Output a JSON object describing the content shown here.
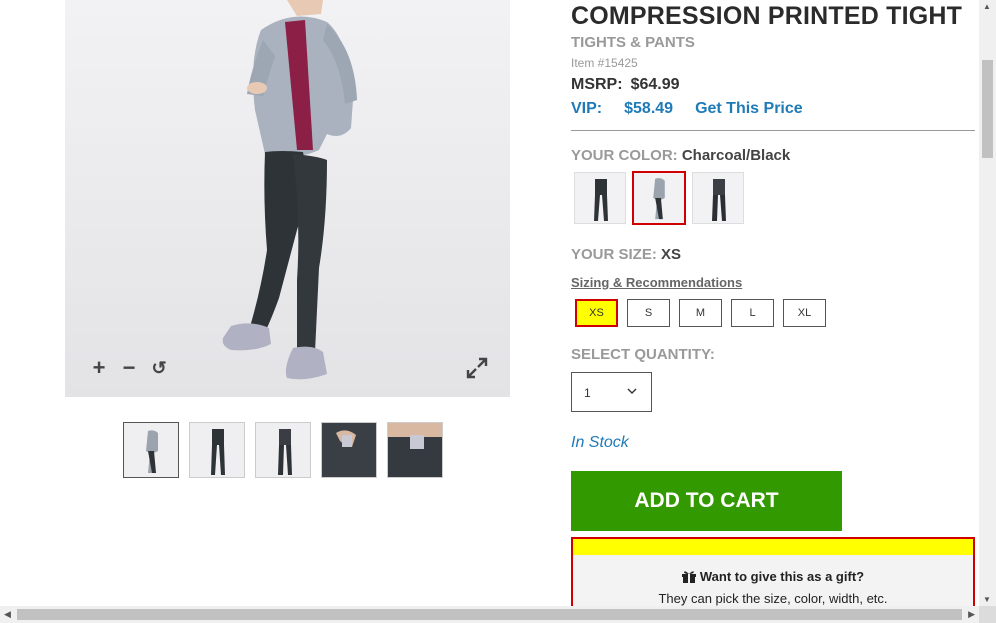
{
  "product": {
    "title": "COMPRESSION PRINTED TIGHT",
    "category": "TIGHTS & PANTS",
    "item_number": "Item #15425",
    "msrp_label": "MSRP:",
    "msrp_value": "$64.99",
    "vip_label": "VIP:",
    "vip_value": "$58.49",
    "vip_link": "Get This Price"
  },
  "gallery": {
    "zoom_in_icon": "plus-icon",
    "zoom_out_icon": "minus-icon",
    "reset_icon": "rotate-icon",
    "expand_icon": "expand-icon",
    "thumbnail_count": 5,
    "active_thumbnail": 1
  },
  "color": {
    "label": "YOUR COLOR:",
    "selected": "Charcoal/Black",
    "swatch_count": 3,
    "selected_swatch": 2
  },
  "size": {
    "label": "YOUR SIZE:",
    "selected": "XS",
    "guide_link": "Sizing & Recommendations",
    "options": [
      "XS",
      "S",
      "M",
      "L",
      "XL"
    ]
  },
  "quantity": {
    "label": "SELECT QUANTITY:",
    "value": "1"
  },
  "stock_status": "In Stock",
  "add_to_cart": "ADD TO CART",
  "gift": {
    "title": "Want to give this as a gift?",
    "subtitle": "They can pick the size, color, width, etc."
  },
  "colors": {
    "accent_blue": "#1f7ab8",
    "cart_green": "#339900",
    "highlight_yellow": "#ffff00",
    "highlight_red": "#d10000"
  }
}
